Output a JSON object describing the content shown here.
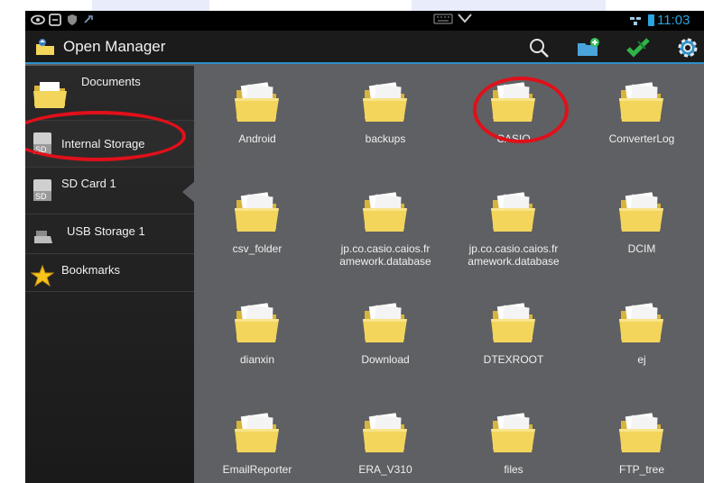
{
  "app": {
    "title": "Open Manager"
  },
  "statusbar": {
    "clock": "11:03",
    "left_icons": [
      "eye-icon",
      "screen-icon",
      "shield-icon",
      "usb-icon"
    ]
  },
  "actionbar": {
    "buttons": [
      "search-icon",
      "new-folder-icon",
      "edit-check-icon",
      "settings-gear-icon"
    ]
  },
  "sidebar": {
    "items": [
      {
        "label": "Documents",
        "icon": "folder-icon"
      },
      {
        "label": "Internal Storage",
        "icon": "sd-storage-icon",
        "selected": true
      },
      {
        "label": "SD Card 1",
        "icon": "sd-card-icon"
      },
      {
        "label": "USB Storage 1",
        "icon": "usb-drive-icon"
      },
      {
        "label": "Bookmarks",
        "icon": "star-icon"
      }
    ]
  },
  "folders": [
    {
      "label": "Android"
    },
    {
      "label": "backups"
    },
    {
      "label": "CASIO"
    },
    {
      "label": "ConverterLog"
    },
    {
      "label": "csv_folder"
    },
    {
      "label": "jp.co.casio.caios.framework.database",
      "line1": "jp.co.casio.caios.fr",
      "line2": "amework.database"
    },
    {
      "label": "jp.co.casio.caios.framework.database",
      "line1": "jp.co.casio.caios.fr",
      "line2": "amework.database"
    },
    {
      "label": "DCIM"
    },
    {
      "label": "dianxin"
    },
    {
      "label": "Download"
    },
    {
      "label": "DTEXROOT"
    },
    {
      "label": "ej"
    },
    {
      "label": "EmailReporter"
    },
    {
      "label": "ERA_V310"
    },
    {
      "label": "files"
    },
    {
      "label": "FTP_tree"
    }
  ],
  "colors": {
    "accent": "#2e8fc9",
    "annotation": "#e0101a",
    "folder": "#f3d55b"
  }
}
